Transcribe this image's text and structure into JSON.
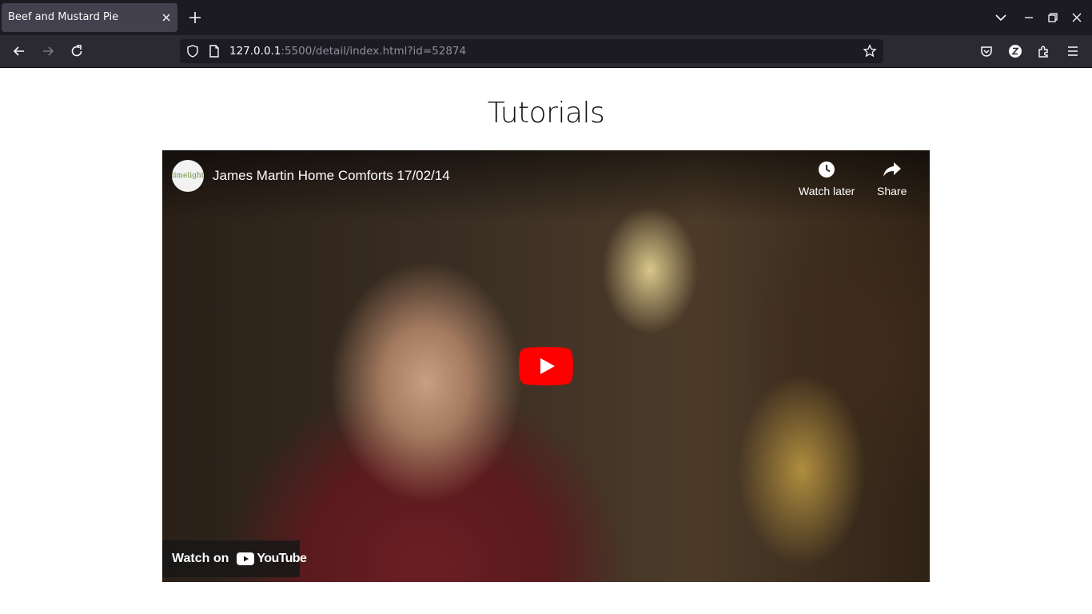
{
  "browser": {
    "tab_title": "Beef and Mustard Pie",
    "url_host": "127.0.0.1",
    "url_rest": ":5500/detail/index.html?id=52874"
  },
  "page": {
    "heading": "Tutorials"
  },
  "video": {
    "title": "James Martin Home Comforts 17/02/14",
    "watch_later_label": "Watch later",
    "share_label": "Share",
    "watch_on_label": "Watch on",
    "youtube_wordmark": "YouTube",
    "channel_logo_text": "limelight"
  },
  "colors": {
    "chrome_dark": "#1c1b22",
    "toolbar": "#2b2a33",
    "youtube_red": "#ff0000"
  }
}
